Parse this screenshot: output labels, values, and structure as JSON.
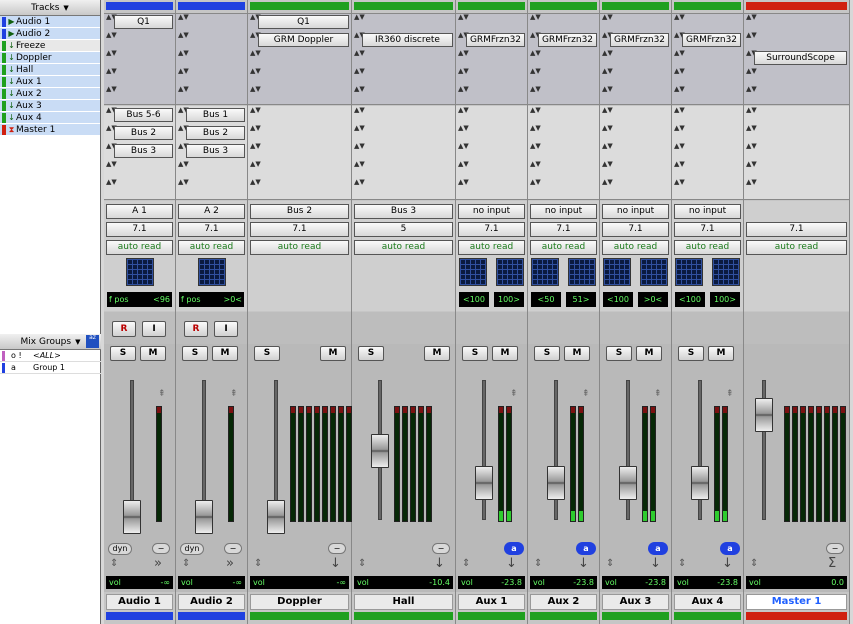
{
  "tracks_panel": {
    "title": "Tracks",
    "items": [
      {
        "name": "Audio 1",
        "color": "#2040e0"
      },
      {
        "name": "Audio 2",
        "color": "#2040e0"
      },
      {
        "name": "Freeze",
        "color": "#20a020"
      },
      {
        "name": "Doppler",
        "color": "#20a020"
      },
      {
        "name": "Hall",
        "color": "#20a020"
      },
      {
        "name": "Aux 1",
        "color": "#20a020"
      },
      {
        "name": "Aux 2",
        "color": "#20a020"
      },
      {
        "name": "Aux 3",
        "color": "#20a020"
      },
      {
        "name": "Aux 4",
        "color": "#20a020"
      },
      {
        "name": "Master 1",
        "color": "#d02010"
      }
    ]
  },
  "mix_groups": {
    "title": "Mix Groups",
    "sort_icon": "az",
    "items": [
      {
        "id": "o !",
        "name": "<ALL>",
        "color": "#c060c0"
      },
      {
        "id": "a",
        "name": "Group 1",
        "color": "#2040e0"
      }
    ]
  },
  "labels": {
    "vol": "vol",
    "R": "R",
    "I": "I",
    "S": "S",
    "M": "M",
    "dyn": "dyn",
    "dash": "−",
    "badge": "a"
  },
  "strips": [
    {
      "name": "Audio 1",
      "color": "#2040e0",
      "inserts": [
        "Q1"
      ],
      "sends": [
        "Bus 5-6",
        "Bus 2",
        "Bus 3"
      ],
      "io": [
        "A 1",
        "7.1",
        "auto read"
      ],
      "pan_display": [
        "f pos",
        "<96"
      ],
      "vol": "-∞",
      "rec": true,
      "dyn": true
    },
    {
      "name": "Audio 2",
      "color": "#2040e0",
      "inserts": [],
      "sends": [
        "Bus 1",
        "Bus 2",
        "Bus 3"
      ],
      "io": [
        "A 2",
        "7.1",
        "auto read"
      ],
      "pan_display": [
        "f pos",
        ">0<"
      ],
      "vol": "-∞",
      "rec": true,
      "dyn": true
    },
    {
      "name": "Doppler",
      "color": "#20a020",
      "inserts": [
        "Q1",
        "GRM Doppler"
      ],
      "sends": [],
      "io": [
        "Bus 2",
        "7.1",
        "auto read"
      ],
      "pan_display": [],
      "vol": "-∞",
      "rec": false,
      "dyn": false
    },
    {
      "name": "Hall",
      "color": "#20a020",
      "inserts": [
        "",
        "IR360 discrete"
      ],
      "sends": [],
      "io": [
        "Bus 3",
        "5",
        "auto read"
      ],
      "pan_display": [],
      "vol": "-10.4",
      "rec": false,
      "dyn": false
    },
    {
      "name": "Aux 1",
      "color": "#20a020",
      "inserts": [
        "",
        "GRMFrzn32"
      ],
      "sends": [],
      "io": [
        "no input",
        "7.1",
        "auto read"
      ],
      "pan_display": [
        "<100",
        "100>"
      ],
      "vol": "-23.8",
      "rec": false,
      "dyn": false
    },
    {
      "name": "Aux 2",
      "color": "#20a020",
      "inserts": [
        "",
        "GRMFrzn32"
      ],
      "sends": [],
      "io": [
        "no input",
        "7.1",
        "auto read"
      ],
      "pan_display": [
        "<50",
        "51>"
      ],
      "vol": "-23.8",
      "rec": false,
      "dyn": false
    },
    {
      "name": "Aux 3",
      "color": "#20a020",
      "inserts": [
        "",
        "GRMFrzn32"
      ],
      "sends": [],
      "io": [
        "no input",
        "7.1",
        "auto read"
      ],
      "pan_display": [
        "<100",
        ">0<"
      ],
      "vol": "-23.8",
      "rec": false,
      "dyn": false
    },
    {
      "name": "Aux 4",
      "color": "#20a020",
      "inserts": [
        "",
        "GRMFrzn32"
      ],
      "sends": [],
      "io": [
        "no input",
        "7.1",
        "auto read"
      ],
      "pan_display": [
        "<100",
        "100>"
      ],
      "vol": "-23.8",
      "rec": false,
      "dyn": false
    },
    {
      "name": "Master 1",
      "color": "#d02010",
      "inserts": [
        "",
        "",
        "SurroundScope"
      ],
      "sends": [],
      "io": [
        "",
        "7.1",
        "auto read"
      ],
      "pan_display": [],
      "vol": "0.0",
      "rec": false,
      "dyn": false
    }
  ]
}
